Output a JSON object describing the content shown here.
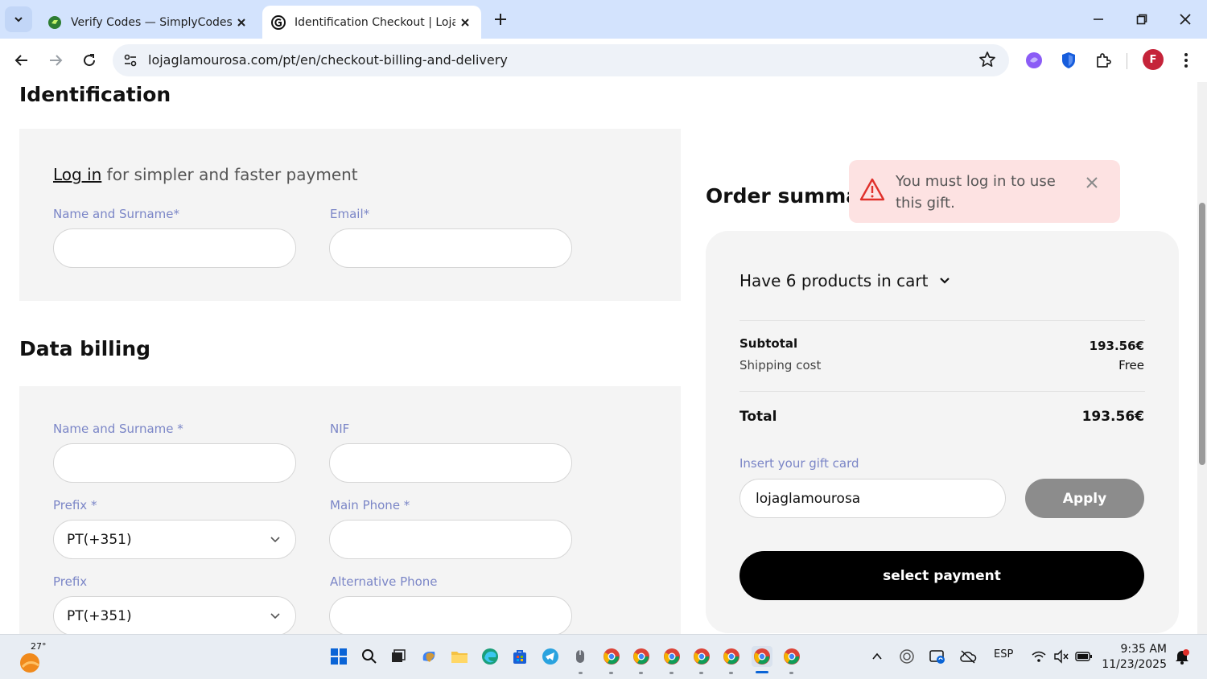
{
  "browser": {
    "tabs": [
      {
        "title": "Verify Codes — SimplyCodes",
        "active": false
      },
      {
        "title": "Identification Checkout | Loja Glamourosa",
        "active": true
      }
    ],
    "url": "lojaglamourosa.com/pt/en/checkout-billing-and-delivery",
    "profile_initial": "F"
  },
  "identification": {
    "heading": "Identification",
    "login_link": "Log in",
    "login_rest": " for simpler and faster payment",
    "name_label": "Name and Surname*",
    "email_label": "Email*"
  },
  "billing": {
    "heading": "Data billing",
    "name_label": "Name and Surname *",
    "nif_label": "NIF",
    "prefix_label": "Prefix *",
    "prefix_value": "PT(+351)",
    "main_phone_label": "Main Phone *",
    "prefix2_label": "Prefix",
    "prefix2_value": "PT(+351)",
    "alt_phone_label": "Alternative Phone"
  },
  "order": {
    "heading": "Order summary",
    "cart_toggle": "Have 6 products in cart",
    "subtotal_label": "Subtotal",
    "subtotal_value": "193.56€",
    "shipping_label": "Shipping cost",
    "shipping_value": "Free",
    "total_label": "Total",
    "total_value": "193.56€",
    "gift_label": "Insert your gift card",
    "gift_value": "lojaglamourosa",
    "apply_label": "Apply",
    "pay_label": "select payment"
  },
  "toast": {
    "message": "You must log in to use this gift.",
    "color": "#fde2e2"
  },
  "taskbar": {
    "temperature": "27°",
    "language": "ESP",
    "time": "9:35 AM",
    "date": "11/23/2025"
  }
}
